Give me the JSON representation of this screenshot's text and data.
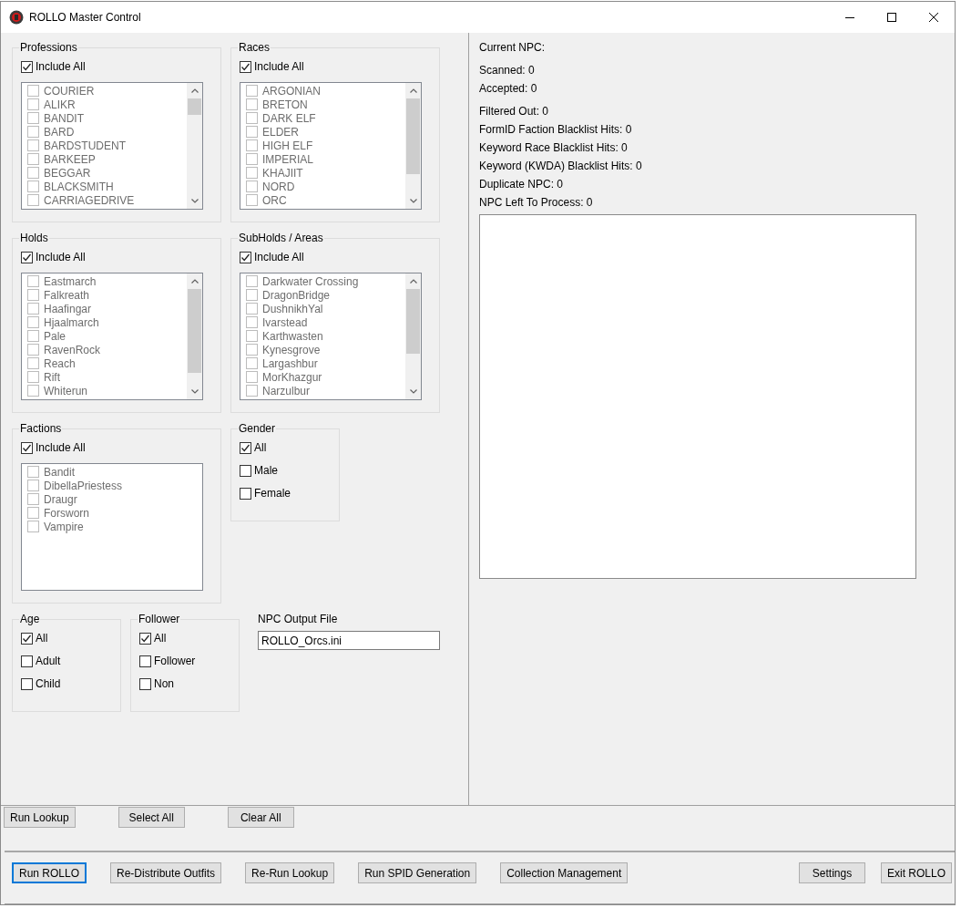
{
  "window": {
    "title": "ROLLO Master Control"
  },
  "filter_groups": [
    {
      "title": "Professions",
      "include_all": {
        "label": "Include All",
        "checked": true
      },
      "scrollable": true,
      "items": [
        {
          "label": "COURIER",
          "checked": false
        },
        {
          "label": "ALIKR",
          "checked": false
        },
        {
          "label": "BANDIT",
          "checked": false
        },
        {
          "label": "BARD",
          "checked": false
        },
        {
          "label": "BARDSTUDENT",
          "checked": false
        },
        {
          "label": "BARKEEP",
          "checked": false
        },
        {
          "label": "BEGGAR",
          "checked": false
        },
        {
          "label": "BLACKSMITH",
          "checked": false
        },
        {
          "label": "CARRIAGEDRIVE",
          "checked": false
        }
      ]
    },
    {
      "title": "Races",
      "include_all": {
        "label": "Include All",
        "checked": true
      },
      "scrollable": true,
      "items": [
        {
          "label": "ARGONIAN",
          "checked": false
        },
        {
          "label": "BRETON",
          "checked": false
        },
        {
          "label": "DARK ELF",
          "checked": false
        },
        {
          "label": "ELDER",
          "checked": false
        },
        {
          "label": "HIGH ELF",
          "checked": false
        },
        {
          "label": "IMPERIAL",
          "checked": false
        },
        {
          "label": "KHAJIIT",
          "checked": false
        },
        {
          "label": "NORD",
          "checked": false
        },
        {
          "label": "ORC",
          "checked": false
        }
      ]
    },
    {
      "title": "Holds",
      "include_all": {
        "label": "Include All",
        "checked": true
      },
      "scrollable": true,
      "items": [
        {
          "label": "Eastmarch",
          "checked": false
        },
        {
          "label": "Falkreath",
          "checked": false
        },
        {
          "label": "Haafingar",
          "checked": false
        },
        {
          "label": "Hjaalmarch",
          "checked": false
        },
        {
          "label": "Pale",
          "checked": false
        },
        {
          "label": "RavenRock",
          "checked": false
        },
        {
          "label": "Reach",
          "checked": false
        },
        {
          "label": "Rift",
          "checked": false
        },
        {
          "label": "Whiterun",
          "checked": false
        }
      ]
    },
    {
      "title": "SubHolds / Areas",
      "include_all": {
        "label": "Include All",
        "checked": true
      },
      "scrollable": true,
      "items": [
        {
          "label": "Darkwater Crossing",
          "checked": false
        },
        {
          "label": "DragonBridge",
          "checked": false
        },
        {
          "label": "DushnikhYal",
          "checked": false
        },
        {
          "label": "Ivarstead",
          "checked": false
        },
        {
          "label": "Karthwasten",
          "checked": false
        },
        {
          "label": "Kynesgrove",
          "checked": false
        },
        {
          "label": "Largashbur",
          "checked": false
        },
        {
          "label": "MorKhazgur",
          "checked": false
        },
        {
          "label": "Narzulbur",
          "checked": false
        }
      ]
    },
    {
      "title": "Factions",
      "include_all": {
        "label": "Include All",
        "checked": true
      },
      "scrollable": false,
      "items": [
        {
          "label": "Bandit",
          "checked": false
        },
        {
          "label": "DibellaPriestess",
          "checked": false
        },
        {
          "label": "Draugr",
          "checked": false
        },
        {
          "label": "Forsworn",
          "checked": false
        },
        {
          "label": "Vampire",
          "checked": false
        }
      ]
    }
  ],
  "gender": {
    "title": "Gender",
    "options": [
      {
        "label": "All",
        "checked": true
      },
      {
        "label": "Male",
        "checked": false
      },
      {
        "label": "Female",
        "checked": false
      }
    ]
  },
  "age": {
    "title": "Age",
    "options": [
      {
        "label": "All",
        "checked": true
      },
      {
        "label": "Adult",
        "checked": false
      },
      {
        "label": "Child",
        "checked": false
      }
    ]
  },
  "follower": {
    "title": "Follower",
    "options": [
      {
        "label": "All",
        "checked": true
      },
      {
        "label": "Follower",
        "checked": false
      },
      {
        "label": "Non",
        "checked": false
      }
    ]
  },
  "output_file": {
    "label": "NPC Output File",
    "value": "ROLLO_Orcs.ini"
  },
  "stats": [
    [
      "Current NPC:"
    ],
    [
      "Scanned: 0",
      "Accepted: 0"
    ],
    [
      "Filtered Out: 0",
      "FormID Faction Blacklist Hits: 0",
      "Keyword Race Blacklist Hits: 0",
      "Keyword (KWDA) Blacklist Hits: 0",
      "Duplicate NPC: 0",
      "NPC Left To Process: 0"
    ]
  ],
  "lookup_buttons": [
    "Run Lookup",
    "Select All",
    "Clear All"
  ],
  "action_buttons": [
    {
      "label": "Run ROLLO",
      "focused": true
    },
    {
      "label": "Re-Distribute Outfits",
      "focused": false
    },
    {
      "label": "Re-Run Lookup",
      "focused": false
    },
    {
      "label": "Run SPID Generation",
      "focused": false
    },
    {
      "label": "Collection Management",
      "focused": false
    }
  ],
  "end_buttons": [
    {
      "label": "Settings",
      "focused": false
    },
    {
      "label": "Exit ROLLO",
      "focused": false
    }
  ]
}
